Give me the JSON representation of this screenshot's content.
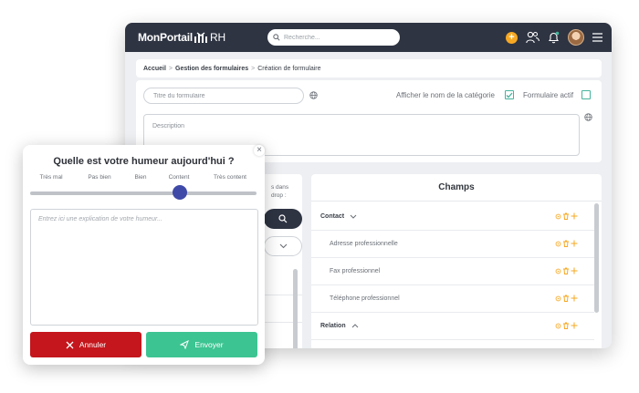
{
  "topbar": {
    "logo_text": "MonPortail",
    "logo_suffix": "RH",
    "search_placeholder": "Recherche...",
    "add_badge": "+"
  },
  "breadcrumb": {
    "items": [
      "Accueil",
      "Gestion des formulaires",
      "Création de formulaire"
    ],
    "separator": ">"
  },
  "form": {
    "title_placeholder": "Titre du formulaire",
    "show_category_label": "Afficher le nom de la catégorie",
    "show_category_checked": true,
    "active_label": "Formulaire actif",
    "active_checked": false,
    "description_placeholder": "Description"
  },
  "left_panel": {
    "hint_text": "s dans drop :"
  },
  "champs": {
    "title": "Champs",
    "rows": [
      {
        "label": "Contact",
        "type": "group",
        "expanded": true
      },
      {
        "label": "Adresse professionnelle",
        "type": "item"
      },
      {
        "label": "Fax professionnel",
        "type": "item"
      },
      {
        "label": "Téléphone professionnel",
        "type": "item"
      },
      {
        "label": "Relation",
        "type": "group",
        "expanded": false
      }
    ]
  },
  "mood_dialog": {
    "title": "Quelle est votre humeur aujourd'hui ?",
    "scale": [
      "Très mal",
      "Pas bien",
      "Bien",
      "Content",
      "Très content"
    ],
    "selected_index": 3,
    "slider_value": 0.66,
    "textarea_placeholder": "Entrez ici une explication de votre humeur...",
    "cancel_label": "Annuler",
    "send_label": "Envoyer",
    "close_glyph": "×"
  },
  "colors": {
    "topbar": "#2e3442",
    "accent_orange": "#f7a823",
    "accent_green": "#45b39d",
    "cancel": "#c4161c",
    "send": "#3cc492",
    "slider_thumb": "#3f4aa8"
  }
}
